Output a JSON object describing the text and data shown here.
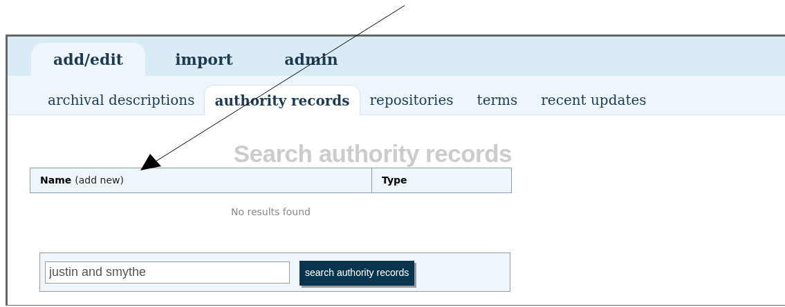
{
  "main_tabs": [
    {
      "label": "add/edit",
      "selected": true
    },
    {
      "label": "import",
      "selected": false
    },
    {
      "label": "admin",
      "selected": false
    }
  ],
  "sub_tabs": [
    {
      "label": "archival descriptions",
      "selected": false
    },
    {
      "label": "authority records",
      "selected": true
    },
    {
      "label": "repositories",
      "selected": false
    },
    {
      "label": "terms",
      "selected": false
    },
    {
      "label": "recent updates",
      "selected": false
    }
  ],
  "page_title": "Search authority records",
  "table": {
    "columns": [
      {
        "label": "Name",
        "link": "(add new)"
      },
      {
        "label": "Type"
      }
    ],
    "empty_message": "No results found"
  },
  "search": {
    "value": "justin and smythe",
    "button": "search authority records"
  }
}
